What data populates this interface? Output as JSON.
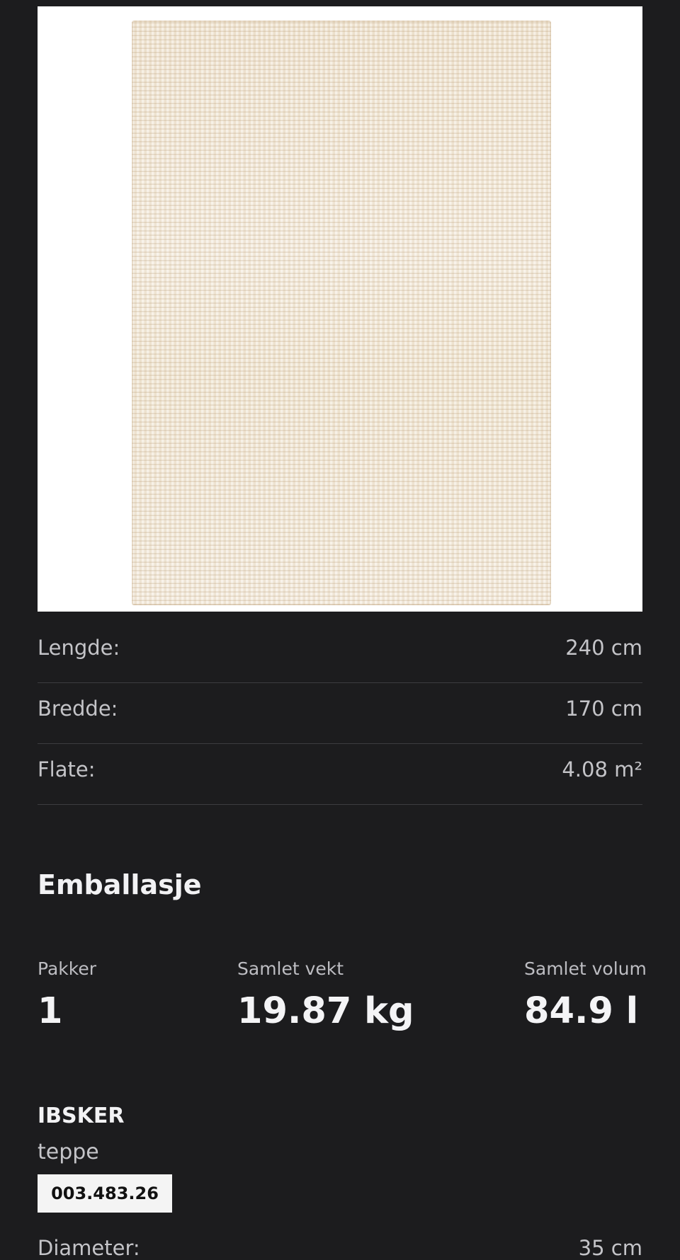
{
  "product_image": {
    "alt": "IBSKER teppe"
  },
  "specs": [
    {
      "label": "Lengde:",
      "value": "240 cm"
    },
    {
      "label": "Bredde:",
      "value": "170 cm"
    },
    {
      "label": "Flate:",
      "value": "4.08 m²"
    }
  ],
  "packaging": {
    "title": "Emballasje",
    "packages": {
      "label": "Pakker",
      "value": "1"
    },
    "total_weight": {
      "label": "Samlet vekt",
      "value": "19.87 kg"
    },
    "total_volume": {
      "label": "Samlet volum",
      "value": "84.9 l"
    }
  },
  "product": {
    "name": "IBSKER",
    "type": "teppe",
    "article_number": "003.483.26"
  },
  "next_row": {
    "label": "Diameter:",
    "value": "35 cm"
  }
}
